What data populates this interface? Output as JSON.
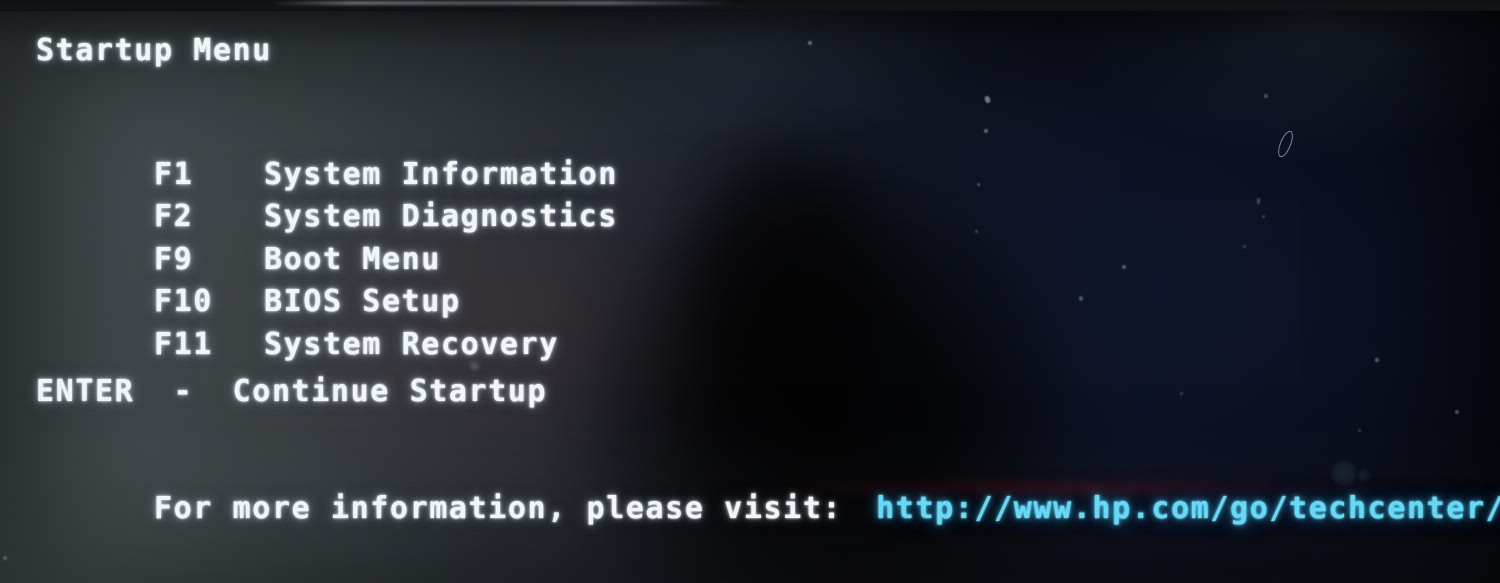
{
  "screen": {
    "title": "Startup Menu",
    "background_left_color": "#474f51",
    "background_right_color": "#03050a",
    "text_color": "#f2f6f8",
    "url_color": "#63dbf8"
  },
  "menu": {
    "items": [
      {
        "key": "F1",
        "label": "System Information"
      },
      {
        "key": "F2",
        "label": "System Diagnostics"
      },
      {
        "key": "F9",
        "label": "Boot Menu"
      },
      {
        "key": "F10",
        "label": "BIOS Setup"
      },
      {
        "key": "F11",
        "label": "System Recovery"
      }
    ]
  },
  "continue": {
    "key": "ENTER",
    "separator": "-",
    "label": "Continue Startup",
    "full_text": "ENTER  -  Continue Startup"
  },
  "footer": {
    "prompt": "For more information, please visit:",
    "url": "http://www.hp.com/go/techcenter/startup"
  }
}
